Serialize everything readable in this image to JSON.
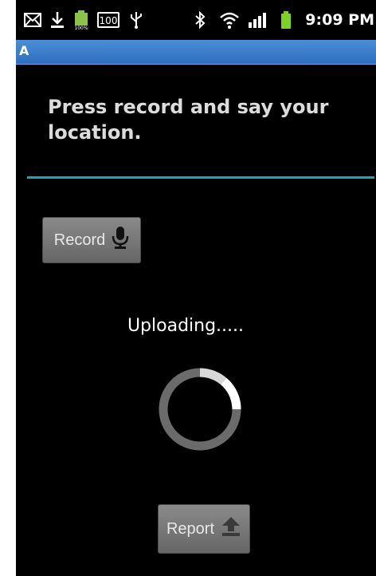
{
  "status_bar": {
    "time": "9:09 PM",
    "badge": "100",
    "icons": [
      "mail-icon",
      "download-icon",
      "battery-100-icon",
      "badge-100-icon",
      "usb-icon",
      "bluetooth-icon",
      "wifi-icon",
      "signal-icon",
      "battery-icon"
    ]
  },
  "app": {
    "title": "A"
  },
  "main": {
    "prompt": "Press record and say your location.",
    "record_label": "Record",
    "status_text": "Uploading.....",
    "report_label": "Report"
  },
  "colors": {
    "accent_divider": "#1aa5b8",
    "title_bar": "#3a7cc9",
    "button": "#777777"
  }
}
